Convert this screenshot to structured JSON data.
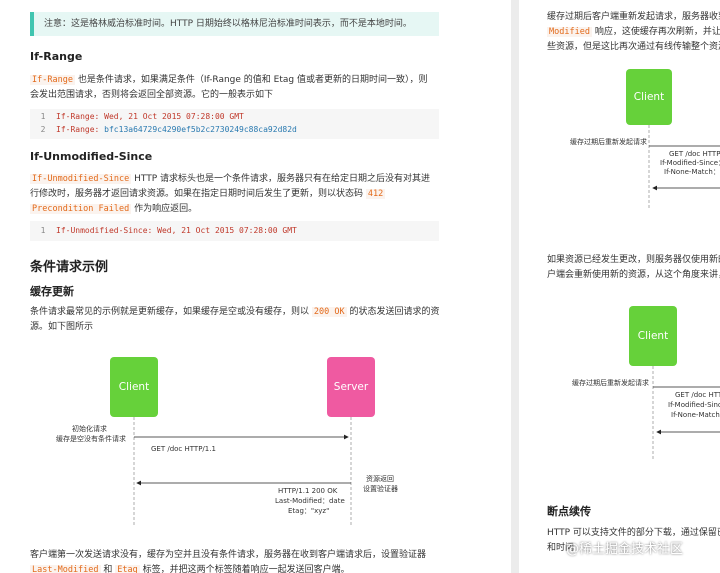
{
  "left": {
    "note": "注意：这是格林威治标准时间。HTTP 日期始终以格林尼治标准时间表示，而不是本地时间。",
    "if_range": {
      "heading": "If-Range",
      "code_term": "If-Range",
      "text1": " 也是条件请求，如果满足条件（If-Range 的值和 Etag 值或者更新的日期时间一致），则",
      "text2": "会发出范围请求，否则将会返回全部资源。它的一般表示如下",
      "code": [
        {
          "num": "1",
          "key": "If-Range:",
          "val": " Wed, 21 Oct 2015 07:28:00 GMT"
        },
        {
          "num": "2",
          "key": "If-Range:",
          "val": " bfc13a64729c4290ef5b2c2730249c88ca92d82d"
        }
      ]
    },
    "if_unmodified": {
      "heading": "If-Unmodified-Since",
      "code_term": "If-Unmodified-Since",
      "text1": " HTTP 请求标头也是一个条件请求，服务器只有在给定日期之后没有对其进",
      "text2": "行修改时，服务器才返回请求资源。如果在指定日期时间后发生了更新，则以状态码 ",
      "status_code": "412",
      "status_text": "Precondition Failed",
      "text3": " 作为响应返回。",
      "code": [
        {
          "num": "1",
          "key": "If-Unmodified-Since:",
          "val": " Wed, 21 Oct 2015 07:28:00 GMT"
        }
      ]
    },
    "example_heading": "条件请求示例",
    "cache_heading": "缓存更新",
    "cache_text1": "条件请求最常见的示例就是更新缓存，如果缓存是空或没有缓存，则以 ",
    "cache_code": "200 OK",
    "cache_text2": " 的状态发送回请求的资",
    "cache_text3": "源。如下图所示",
    "diagram": {
      "client": "Client",
      "server": "Server",
      "note_left1": "初始化请求",
      "note_left2": "缓存是空没有条件请求",
      "request": "GET /doc  HTTP/1.1",
      "note_right1": "资源返回",
      "note_right2": "设置验证器",
      "resp1": "HTTP/1.1  200  OK",
      "resp2": "Last-Modified：date",
      "resp3": "Etag：\"xyz\""
    },
    "bottom_text1": "客户端第一次发送请求没有，缓存为空并且没有条件请求，服务器在收到客户端请求后，设置验证器",
    "bottom_code1": "Last-Modified",
    "bottom_and": " 和 ",
    "bottom_code2": "Etag",
    "bottom_text2": " 标签，并把这两个标签随着响应一起发送回客户端。"
  },
  "right": {
    "top_text1": "缓存过期后客户端重新发起请求，服务器收到",
    "top_code": "Modified",
    "top_text2": " 响应，这使缓存再次刷新，并让客",
    "top_text3": "些资源，但是这比再次通过有线传输整个资源",
    "diagram1": {
      "client": "Client",
      "note": "缓存过期后重新发起请求",
      "req1": "GET /doc  HTTP/",
      "req2": "If-Modified-Since：",
      "req3": "If-None-Match：\""
    },
    "mid_text1": "如果资源已经发生更改，则服务器仅使用新的",
    "mid_text2": "户端会重新使用新的资源，从这个角度来讲，",
    "diagram2": {
      "client": "Client",
      "note": "缓存过期后重新发起请求",
      "req1": "GET /doc  HTT",
      "req2": "If-Modified-Sinc",
      "req3": "If-None-Match："
    },
    "resume_heading": "断点续传",
    "resume_text1": "HTTP 可以支持文件的部分下载，通过保留已",
    "resume_text2": "和时间",
    "watermark": "@稀土掘金技术社区"
  }
}
